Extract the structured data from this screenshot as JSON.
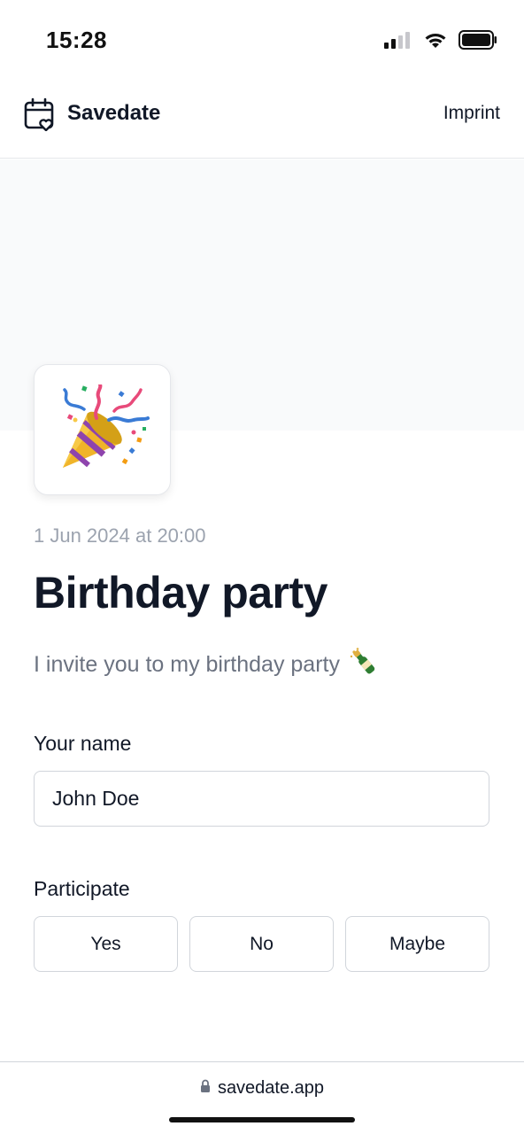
{
  "status_bar": {
    "time": "15:28",
    "icons": [
      "signal-icon",
      "wifi-icon",
      "battery-icon"
    ]
  },
  "header": {
    "brand": "Savedate",
    "logo_icon": "calendar-heart-icon",
    "imprint_label": "Imprint"
  },
  "event": {
    "tile_icon": "party-popper-icon",
    "date": "1 Jun 2024 at 20:00",
    "title": "Birthday party",
    "description": "I invite you to my birthday party",
    "description_icon": "champagne-bottle-icon"
  },
  "form": {
    "name_label": "Your name",
    "name_value": "John Doe",
    "participate_label": "Participate",
    "options": [
      "Yes",
      "No",
      "Maybe"
    ]
  },
  "browser": {
    "url": "savedate.app",
    "lock_icon": "lock-icon"
  },
  "colors": {
    "text_primary": "#111827",
    "text_muted": "#9ca3af",
    "text_secondary": "#6b7280",
    "border": "#d1d5db",
    "hero_background": "#f9fafb"
  }
}
